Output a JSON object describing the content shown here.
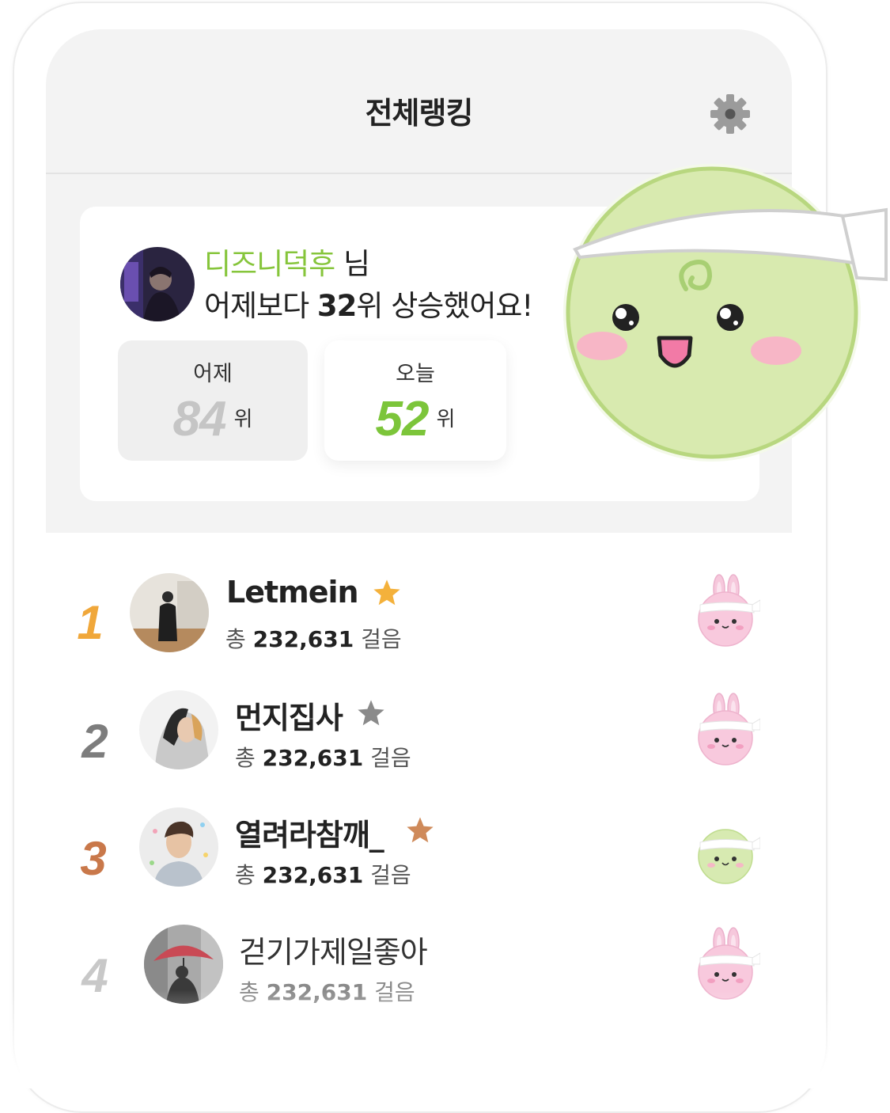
{
  "header": {
    "title": "전체랭킹",
    "settings_icon": "gear-icon"
  },
  "summary": {
    "user_name": "디즈니덕후",
    "honorific": " 님",
    "message_prefix": "어제보다 ",
    "change": "32",
    "message_suffix": "위 상승했어요!",
    "yesterday": {
      "label": "어제",
      "rank": "84",
      "unit": "위"
    },
    "today": {
      "label": "오늘",
      "rank": "52",
      "unit": "위"
    }
  },
  "ranking": [
    {
      "rank": "1",
      "name": "Letmein",
      "steps_prefix": "총 ",
      "steps": "232,631",
      "steps_unit": " 걸음",
      "badge": "gold-star-icon",
      "pet": "pink-bunny-icon"
    },
    {
      "rank": "2",
      "name": "먼지집사",
      "steps_prefix": "총 ",
      "steps": "232,631",
      "steps_unit": " 걸음",
      "badge": "silver-star-icon",
      "pet": "pink-bunny-icon"
    },
    {
      "rank": "3",
      "name": "열려라참깨_",
      "steps_prefix": "총 ",
      "steps": "232,631",
      "steps_unit": " 걸음",
      "badge": "bronze-star-icon",
      "pet": "green-blob-icon"
    },
    {
      "rank": "4",
      "name": "걷기가제일좋아",
      "steps_prefix": "총 ",
      "steps": "232,631",
      "steps_unit": " 걸음",
      "badge": "",
      "pet": "pink-bunny-icon"
    }
  ],
  "colors": {
    "accent_green": "#7cc53a",
    "gold": "#f0a73a",
    "silver": "#7d7d7d",
    "bronze": "#c9784a",
    "muted": "#c8c8c8"
  }
}
